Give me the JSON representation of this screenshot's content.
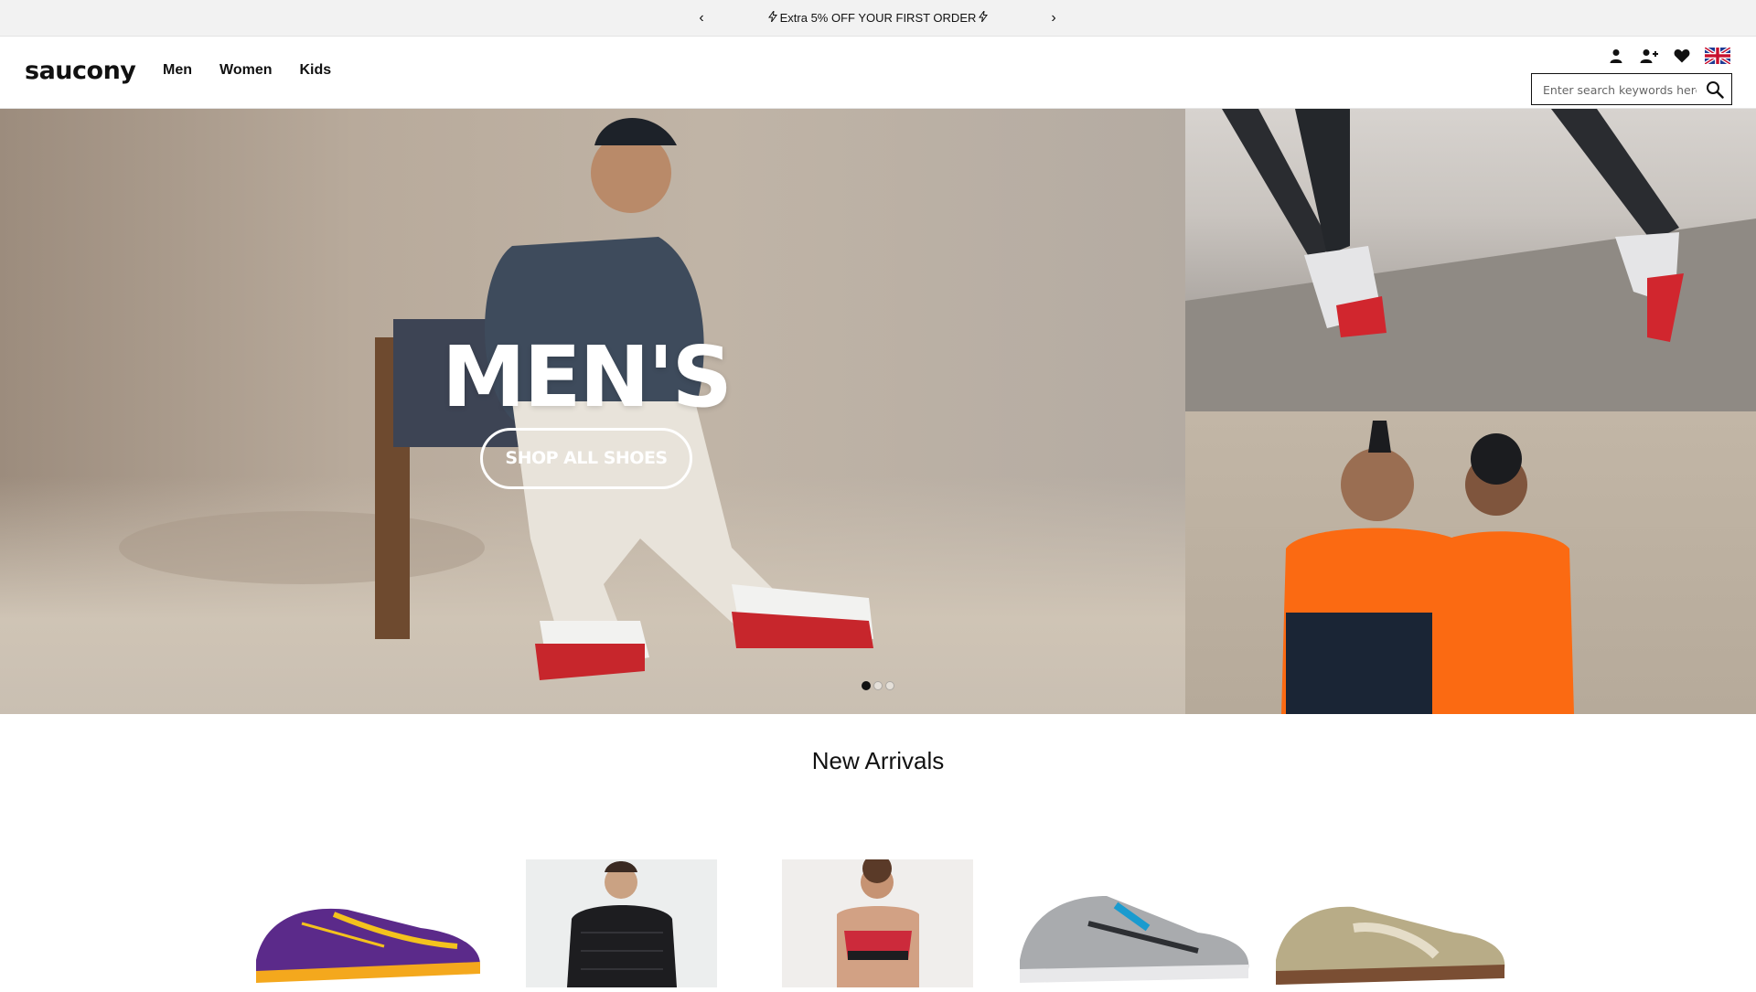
{
  "promo": {
    "message": "Extra 5% OFF YOUR FIRST ORDER",
    "prev": "‹",
    "next": "›"
  },
  "header": {
    "logo": "saucony",
    "nav": [
      {
        "label": "Men"
      },
      {
        "label": "Women"
      },
      {
        "label": "Kids"
      }
    ],
    "icons": [
      "account-icon",
      "add-user-icon",
      "wishlist-heart-icon",
      "uk-flag-icon"
    ],
    "search": {
      "placeholder": "Enter search keywords here",
      "value": ""
    }
  },
  "hero": {
    "title": "MEN'S",
    "cta": "SHOP ALL SHOES",
    "slides": 3,
    "active_slide": 1
  },
  "new_arrivals": {
    "title": "New Arrivals",
    "products": [
      {
        "name": "purple-racing-shoe"
      },
      {
        "name": "black-quilted-jacket"
      },
      {
        "name": "red-sports-bra"
      },
      {
        "name": "grey-running-shoe"
      },
      {
        "name": "tan-suede-sneaker"
      }
    ]
  },
  "colors": {
    "promo_bg": "#f2f2f2",
    "text": "#111111",
    "hero_text": "#ffffff"
  }
}
